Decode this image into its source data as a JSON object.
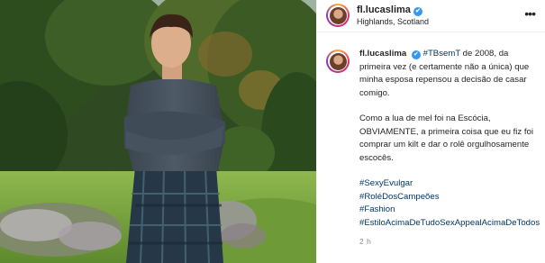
{
  "post": {
    "username": "fl.lucaslima",
    "verified_mark": "✔",
    "location": "Highlands, Scotland",
    "more_icon": "•••",
    "timestamp": "2 h"
  },
  "caption": {
    "username": "fl.lucaslima",
    "hashtag_intro": "#TBsemT",
    "intro_text": " de 2008, da primeira vez (e certamente não a única) que minha esposa repensou a decisão de casar comigo.",
    "paragraph2": "Como a lua de mel foi na Escócia, OBVIAMENTE, a primeira coisa que eu fiz foi comprar um kilt e dar o rolê orgulhosamente escocês.",
    "hashtags": [
      "#SexyEvulgar",
      "#RoléDosCampeões",
      "#Fashion",
      "#EstiloAcimaDeTudoSexAppealAcimaDeTodos"
    ]
  },
  "colors": {
    "hashtag": "#00376b",
    "verified": "#3897f0",
    "timestamp": "#8e8e8e"
  },
  "icons": [
    "verified-badge-icon",
    "more-options-icon"
  ]
}
